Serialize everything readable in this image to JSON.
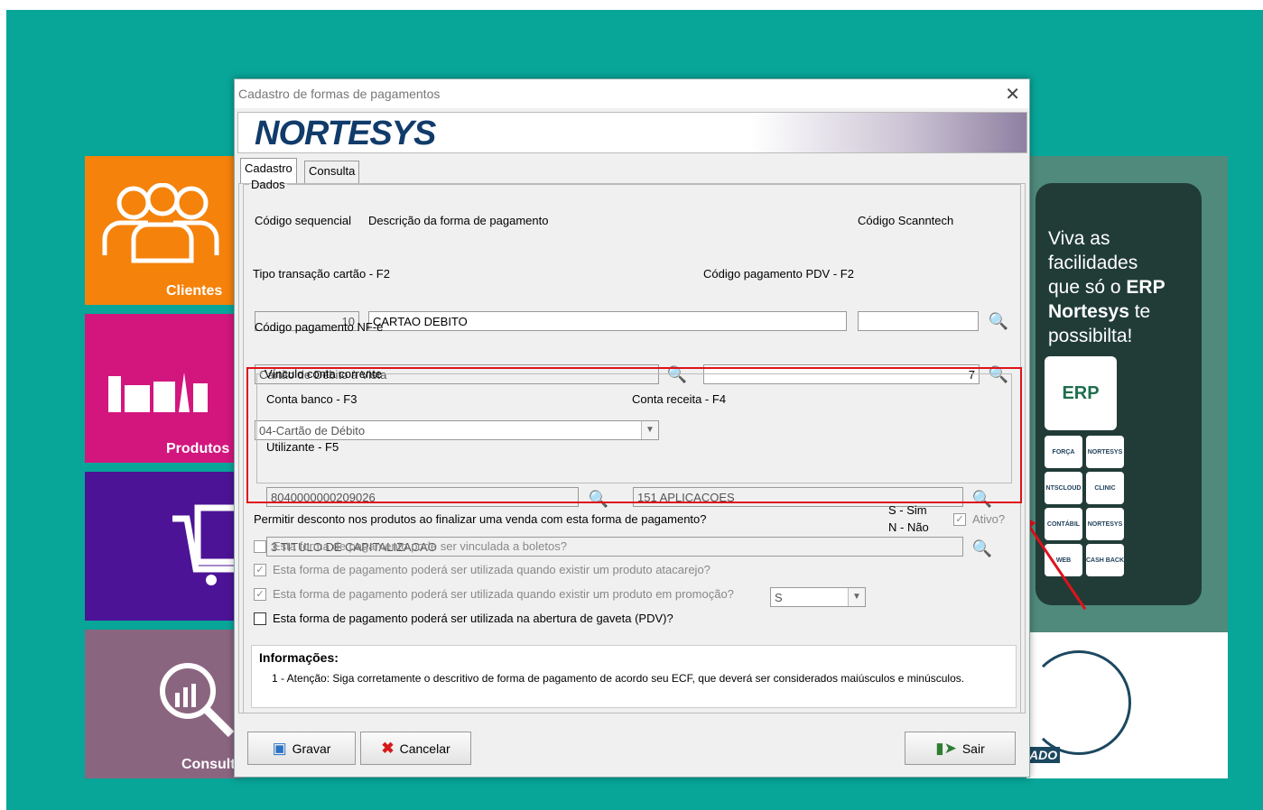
{
  "background": {
    "tiles": [
      {
        "label": "Clientes",
        "icon": "users-icon"
      },
      {
        "label": "Produtos",
        "icon": "products-icon"
      },
      {
        "label": "",
        "icon": "cart-register-icon"
      },
      {
        "label": "Consult",
        "icon": "report-search-icon"
      }
    ],
    "banner": {
      "line1": "Viva as",
      "line2": "facilidades",
      "line3a": "que só o ",
      "line3b": "ERP",
      "line4a": "Nortesys",
      "line4b": " te",
      "line5": "possibilta!",
      "erp_logo": "ERP",
      "logos": [
        "FORÇA",
        "NORTESYS",
        "NTSCLOUD",
        "CLINIC",
        "CONTÁBIL",
        "NORTESYS",
        "WEB",
        "CASH BACK"
      ],
      "footer_text": "ADO"
    }
  },
  "dialog": {
    "title": "Cadastro de formas de pagamentos",
    "close_glyph": "✕",
    "logo": "NORTESYS",
    "tabs": [
      {
        "label": "Cadastro",
        "active": true
      },
      {
        "label": "Consulta",
        "active": false
      }
    ],
    "dados": {
      "legend": "Dados",
      "codigo_sequencial_label": "Código sequencial",
      "codigo_sequencial_value": "10",
      "descricao_label": "Descrição da forma de pagamento",
      "descricao_value": "CARTAO DEBITO",
      "scanntech_label": "Código Scanntech",
      "scanntech_value": "",
      "tipo_transacao_label": "Tipo transação cartão - F2",
      "tipo_transacao_value": "Cartão de Débito à Vista",
      "codigo_pdv_label": "Código pagamento PDV - F2",
      "codigo_pdv_value": "7",
      "codigo_nfe_label": "Código pagamento NF-e",
      "codigo_nfe_value": "04-Cartão de Débito"
    },
    "vinculo": {
      "legend": "Vínculo conta corrente",
      "conta_banco_label": "Conta banco - F3",
      "conta_banco_value": "8040000000209026",
      "conta_receita_label": "Conta receita - F4",
      "conta_receita_value": "151 APLICACOES",
      "utilizante_label": "Utilizante - F5",
      "utilizante_value": "3 TITULO DE CAPITALIZACAO"
    },
    "desconto_label": "Permitir desconto nos produtos ao finalizar uma venda com esta forma de pagamento?",
    "desconto_value": "S",
    "legend_sim": "S - Sim",
    "legend_nao": "N - Não",
    "ativo_label": "Ativo?",
    "checkboxes": [
      {
        "label": "Esta forma de pagamento pode ser vinculada a boletos?",
        "checked": false,
        "enabled": false
      },
      {
        "label": "Esta forma de pagamento poderá ser utilizada quando existir um produto atacarejo?",
        "checked": true,
        "enabled": false
      },
      {
        "label": "Esta forma de pagamento poderá ser utilizada quando existir um produto em promoção?",
        "checked": true,
        "enabled": false
      },
      {
        "label": "Esta forma de pagamento poderá ser utilizada na abertura de gaveta (PDV)?",
        "checked": false,
        "enabled": true
      }
    ],
    "info": {
      "title": "Informações:",
      "text": "1 - Atenção: Siga corretamente o descritivo de forma de pagamento de acordo seu ECF, que deverá ser considerados maiúsculos e minúsculos."
    },
    "buttons": {
      "gravar": "Gravar",
      "cancelar": "Cancelar",
      "sair": "Sair"
    },
    "check_glyph": "✓",
    "search_glyph": "🔍",
    "dropdown_glyph": "▼"
  },
  "colors": {
    "desktop": "#08a599",
    "highlight_red": "#e0121b",
    "logo_blue": "#103b6a"
  }
}
